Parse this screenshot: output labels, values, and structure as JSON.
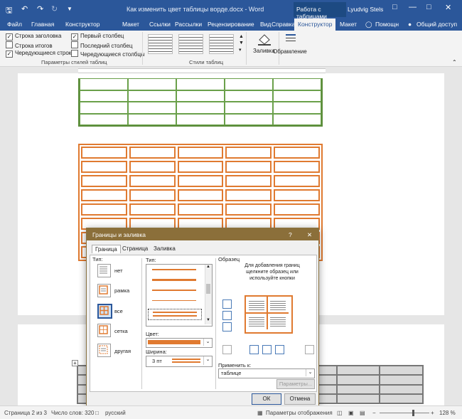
{
  "titlebar": {
    "doc_title": "Как изменить цвет таблицы ворде.docx  -  Word",
    "context_group": "Работа с таблицами",
    "user": "Lyudvig Stels"
  },
  "tabs": [
    "Файл",
    "Главная",
    "Конструктор",
    "Макет",
    "Ссылки",
    "Рассылки",
    "Рецензирование",
    "Вид",
    "Справка",
    "Конструктор",
    "Макет"
  ],
  "help": "Помощн",
  "share": "Общий доступ",
  "ribbon": {
    "options": {
      "header_row": "Строка заголовка",
      "total_row": "Строка итогов",
      "banded_rows": "Чередующиеся строки",
      "first_column": "Первый столбец",
      "last_column": "Последний столбец",
      "banded_columns": "Чередующиеся столбцы",
      "group_label": "Параметры стилей таблиц"
    },
    "styles_label": "Стили таблиц",
    "shading": "Заливка",
    "borders": "Обрамление"
  },
  "dialog": {
    "title": "Границы и заливка",
    "help": "?",
    "tabs": [
      "Граница",
      "Страница",
      "Заливка"
    ],
    "type_label": "Тип:",
    "presets": [
      "нет",
      "рамка",
      "все",
      "сетка",
      "другая"
    ],
    "style_label": "Тип:",
    "color_label": "Цвет:",
    "width_label": "Ширина:",
    "width_value": "3 пт",
    "preview_label": "Образец",
    "preview_hint": "Для добавления границ щелкните образец или используйте кнопки",
    "apply_label": "Применить к:",
    "apply_value": "таблице",
    "params_button": "Параметры...",
    "ok": "ОК",
    "cancel": "Отмена",
    "accent_color": "#e07a30"
  },
  "status": {
    "page": "Страница 2 из 3",
    "words": "Число слов: 320",
    "lang": "русский",
    "display": "Параметры отображения",
    "zoom": "128 %"
  }
}
